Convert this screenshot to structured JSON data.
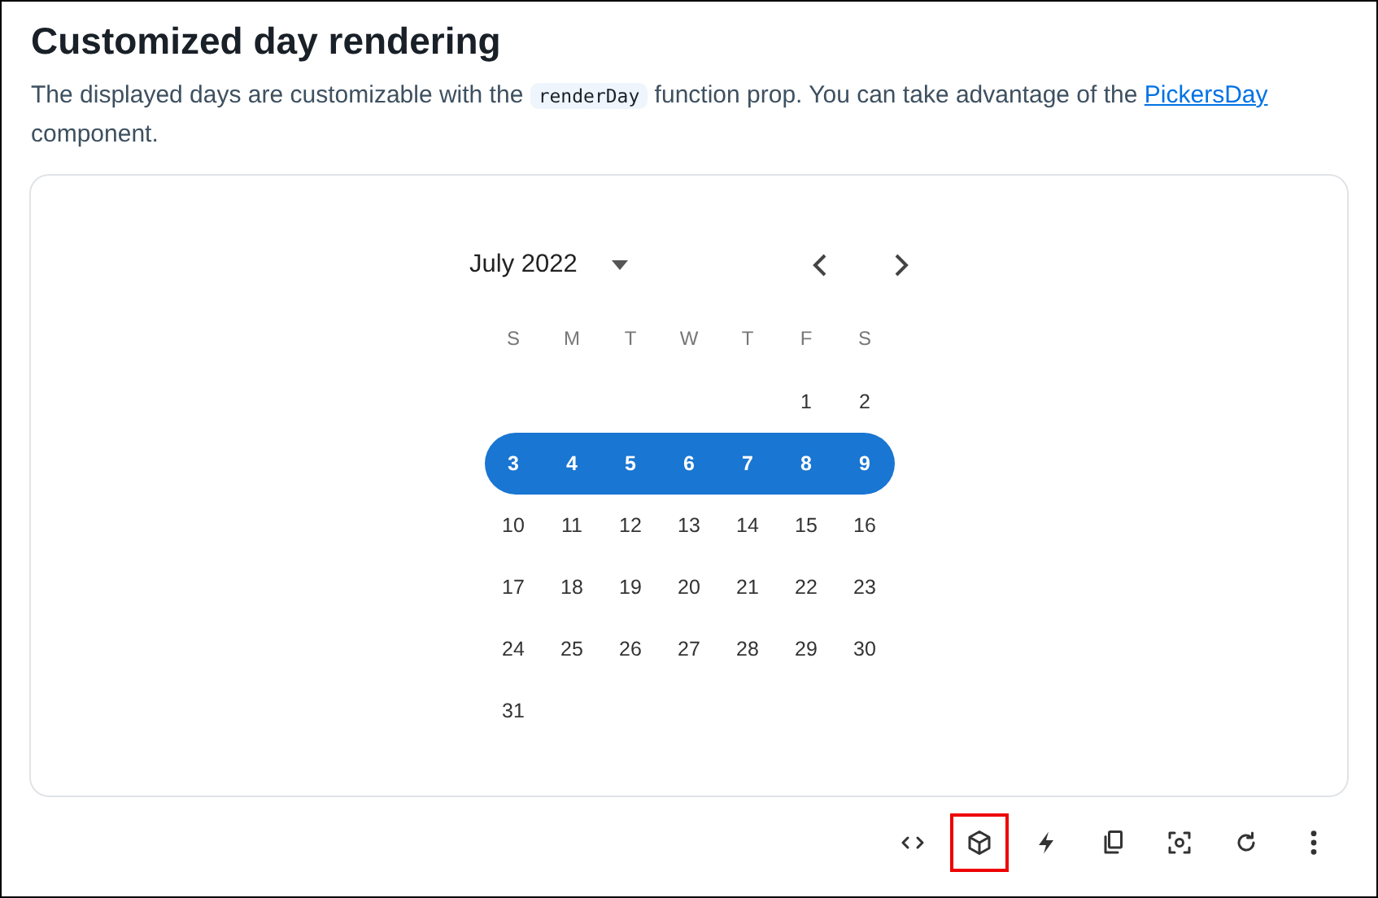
{
  "title": "Customized day rendering",
  "description": {
    "before": "The displayed days are customizable with the",
    "code": "renderDay",
    "middle": "function prop. You can take advantage of the",
    "link": "PickersDay",
    "after": "component."
  },
  "calendar": {
    "month": "July 2022",
    "weekdays": [
      "S",
      "M",
      "T",
      "W",
      "T",
      "F",
      "S"
    ],
    "weeks": [
      {
        "selected": false,
        "days": [
          "1",
          "2"
        ]
      },
      {
        "selected": true,
        "days": [
          "3",
          "4",
          "5",
          "6",
          "7",
          "8",
          "9"
        ]
      },
      {
        "selected": false,
        "days": [
          "10",
          "11",
          "12",
          "13",
          "14",
          "15",
          "16"
        ]
      },
      {
        "selected": false,
        "days": [
          "17",
          "18",
          "19",
          "20",
          "21",
          "22",
          "23"
        ]
      },
      {
        "selected": false,
        "days": [
          "24",
          "25",
          "26",
          "27",
          "28",
          "29",
          "30"
        ]
      },
      {
        "selected": false,
        "days": [
          "31"
        ]
      }
    ]
  },
  "toolbar": [
    {
      "kind": "code",
      "highlighted": false
    },
    {
      "kind": "cube",
      "highlighted": true
    },
    {
      "kind": "bolt",
      "highlighted": false
    },
    {
      "kind": "copy",
      "highlighted": false
    },
    {
      "kind": "screenshot",
      "highlighted": false
    },
    {
      "kind": "refresh",
      "highlighted": false
    },
    {
      "kind": "more",
      "highlighted": false
    }
  ]
}
